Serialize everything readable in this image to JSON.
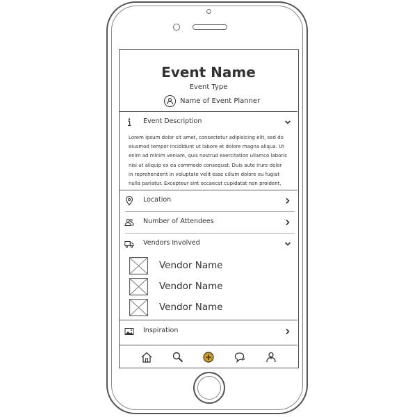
{
  "header": {
    "event_name": "Event Name",
    "event_type": "Event Type",
    "planner_label": "Name of  Event Planner"
  },
  "sections": {
    "description": {
      "label": "Event Description",
      "icon": "info-icon",
      "expanded": true,
      "text": "Lorem ipsum dolor sit amet, consectetur adipisicing elit, sed do eiusmod tempor incididunt ut labore et dolore magna aliqua. Ut enim ad minim veniam, quis nostrud exercitation ullamco laboris nisi ut aliquip ex ea commodo consequat. Duis aute irure dolor in reprehenderit in voluptate velit esse cillum dolore eu fugiat nulla pariatur. Excepteur sint occaecat cupidatat non proident, sunt"
    },
    "location": {
      "label": "Location",
      "icon": "map-pin-icon"
    },
    "attendees": {
      "label": "Number of Attendees",
      "icon": "people-icon"
    },
    "vendors": {
      "label": "Vendors Involved",
      "icon": "truck-icon",
      "expanded": true,
      "items": [
        {
          "name": "Vendor Name"
        },
        {
          "name": "Vendor Name"
        },
        {
          "name": "Vendor Name"
        }
      ]
    },
    "inspiration": {
      "label": "Inspiration",
      "icon": "image-icon"
    }
  },
  "tabbar": {
    "items": [
      {
        "icon": "home-icon"
      },
      {
        "icon": "search-icon"
      },
      {
        "icon": "add-circle-icon",
        "active": true,
        "color": "#d4a017"
      },
      {
        "icon": "chat-icon"
      },
      {
        "icon": "profile-icon"
      }
    ]
  }
}
